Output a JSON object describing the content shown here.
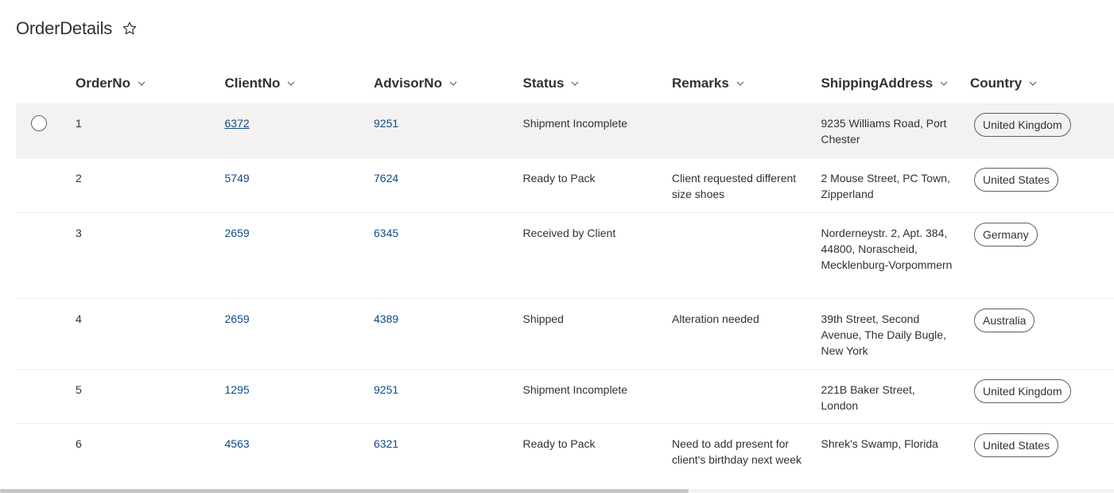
{
  "page": {
    "title": "OrderDetails",
    "favorite_icon": "star-outline-icon"
  },
  "columns": [
    {
      "key": "OrderNo",
      "label": "OrderNo",
      "icon": "chevron-down-icon"
    },
    {
      "key": "ClientNo",
      "label": "ClientNo",
      "icon": "chevron-down-icon"
    },
    {
      "key": "AdvisorNo",
      "label": "AdvisorNo",
      "icon": "chevron-down-icon"
    },
    {
      "key": "Status",
      "label": "Status",
      "icon": "chevron-down-icon"
    },
    {
      "key": "Remarks",
      "label": "Remarks",
      "icon": "chevron-down-icon"
    },
    {
      "key": "ShippingAddress",
      "label": "ShippingAddress",
      "icon": "chevron-down-icon"
    },
    {
      "key": "Country",
      "label": "Country",
      "icon": "chevron-down-icon"
    }
  ],
  "rows": [
    {
      "order_no": "1",
      "client_no": "6372",
      "advisor_no": "9251",
      "status": "Shipment Incomplete",
      "remarks": "",
      "shipping_address": "9235 Williams Road, Port Chester",
      "country": "United Kingdom",
      "hovered": true
    },
    {
      "order_no": "2",
      "client_no": "5749",
      "advisor_no": "7624",
      "status": "Ready to Pack",
      "remarks": "Client requested different size shoes",
      "shipping_address": "2 Mouse Street, PC Town, Zipperland",
      "country": "United States",
      "hovered": false
    },
    {
      "order_no": "3",
      "client_no": "2659",
      "advisor_no": "6345",
      "status": "Received by Client",
      "remarks": "",
      "shipping_address": "Norderneystr. 2, Apt. 384, 44800, Norascheid, Mecklenburg-Vorpommern",
      "country": "Germany",
      "hovered": false
    },
    {
      "order_no": "4",
      "client_no": "2659",
      "advisor_no": "4389",
      "status": "Shipped",
      "remarks": "Alteration needed",
      "shipping_address": "39th Street, Second Avenue, The Daily Bugle, New York",
      "country": "Australia",
      "hovered": false
    },
    {
      "order_no": "5",
      "client_no": "1295",
      "advisor_no": "9251",
      "status": "Shipment Incomplete",
      "remarks": "",
      "shipping_address": "221B Baker Street, London",
      "country": "United Kingdom",
      "hovered": false
    },
    {
      "order_no": "6",
      "client_no": "4563",
      "advisor_no": "6321",
      "status": "Ready to Pack",
      "remarks": "Need to add present for client's birthday next week",
      "shipping_address": "Shrek's Swamp, Florida",
      "country": "United States",
      "hovered": false
    }
  ],
  "scroll": {
    "horizontal_position_fraction": 0.0,
    "visible_fraction": 0.62
  },
  "colors": {
    "link": "#0f4a85",
    "row_hover": "#f3f2f1",
    "text": "#323130"
  }
}
